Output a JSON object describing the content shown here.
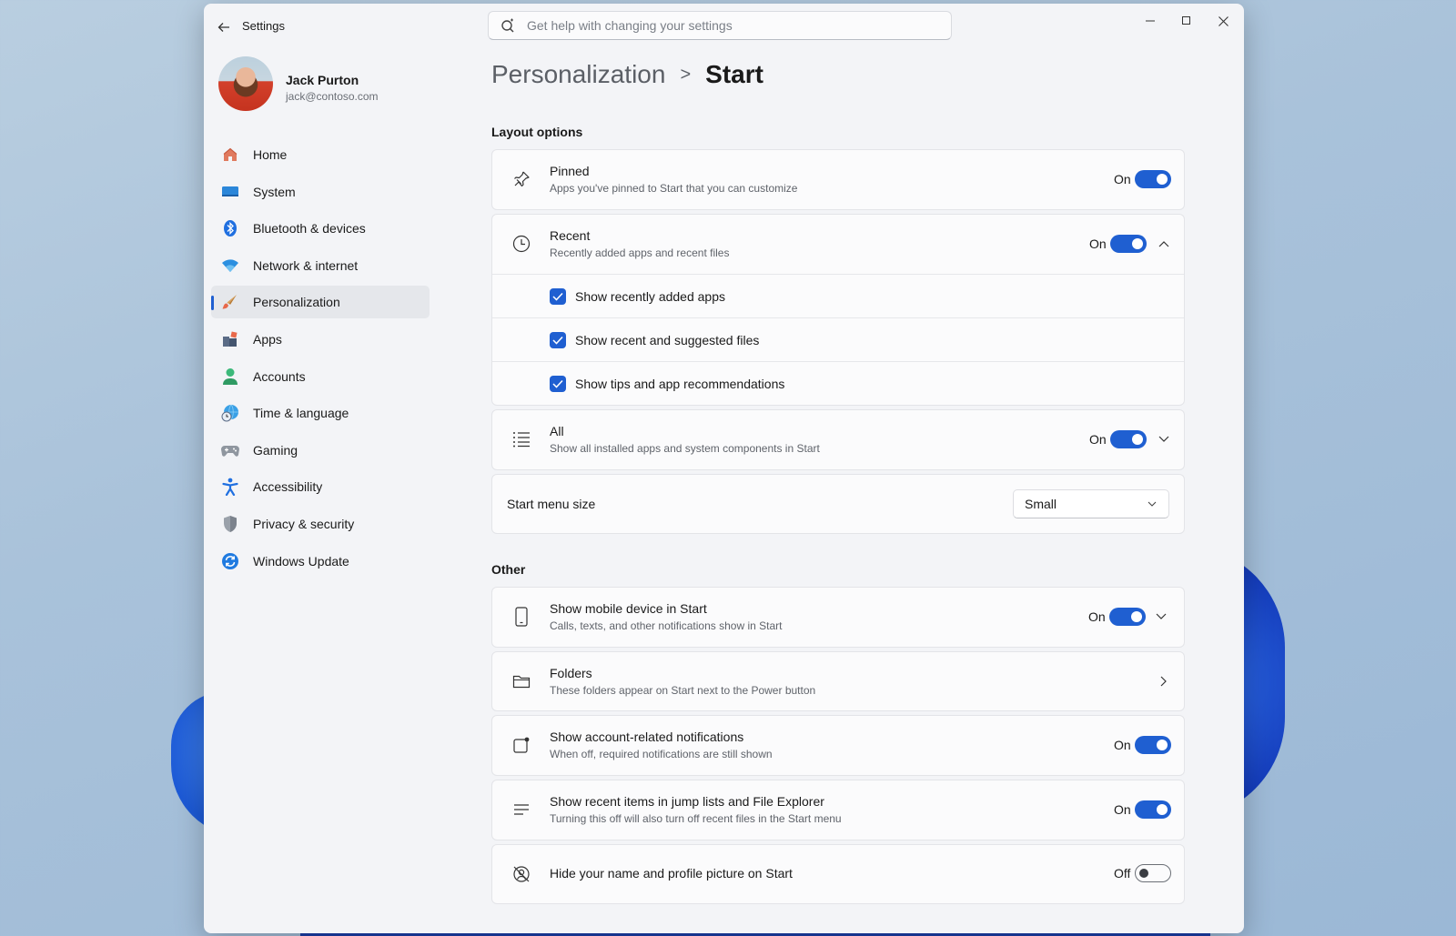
{
  "window": {
    "title": "Settings",
    "search_placeholder": "Get help with changing your settings"
  },
  "profile": {
    "name": "Jack Purton",
    "email": "jack@contoso.com"
  },
  "nav": {
    "items": [
      {
        "label": "Home",
        "icon": "home-icon"
      },
      {
        "label": "System",
        "icon": "system-icon"
      },
      {
        "label": "Bluetooth & devices",
        "icon": "bluetooth-icon"
      },
      {
        "label": "Network & internet",
        "icon": "wifi-icon"
      },
      {
        "label": "Personalization",
        "icon": "brush-icon",
        "active": true
      },
      {
        "label": "Apps",
        "icon": "apps-icon"
      },
      {
        "label": "Accounts",
        "icon": "account-icon"
      },
      {
        "label": "Time & language",
        "icon": "globe-clock-icon"
      },
      {
        "label": "Gaming",
        "icon": "gamepad-icon"
      },
      {
        "label": "Accessibility",
        "icon": "accessibility-icon"
      },
      {
        "label": "Privacy & security",
        "icon": "shield-icon"
      },
      {
        "label": "Windows Update",
        "icon": "update-icon"
      }
    ]
  },
  "breadcrumb": {
    "parent": "Personalization",
    "separator": ">",
    "current": "Start"
  },
  "layout_section": {
    "title": "Layout options",
    "pinned": {
      "title": "Pinned",
      "desc": "Apps you've pinned to Start that you can customize",
      "state": "On",
      "on": true
    },
    "recent": {
      "title": "Recent",
      "desc": "Recently added apps and recent files",
      "state": "On",
      "on": true,
      "expanded": true,
      "options": [
        {
          "label": "Show recently added apps",
          "checked": true
        },
        {
          "label": "Show recent and suggested files",
          "checked": true
        },
        {
          "label": "Show tips and app recommendations",
          "checked": true
        }
      ]
    },
    "all": {
      "title": "All",
      "desc": "Show all installed apps and system components in Start",
      "state": "On",
      "on": true
    },
    "menu_size": {
      "title": "Start menu size",
      "value": "Small"
    }
  },
  "other_section": {
    "title": "Other",
    "mobile": {
      "title": "Show mobile device in Start",
      "desc": "Calls, texts, and other notifications show in Start",
      "state": "On",
      "on": true
    },
    "folders": {
      "title": "Folders",
      "desc": "These folders appear on Start next to the Power button"
    },
    "account_notifications": {
      "title": "Show account-related notifications",
      "desc": "When off, required notifications are still shown",
      "state": "On",
      "on": true
    },
    "recent_items": {
      "title": "Show recent items in jump lists and File Explorer",
      "desc": "Turning this off will also turn off recent files in the Start menu",
      "state": "On",
      "on": true
    },
    "hide_name": {
      "title": "Hide your name and profile picture on Start",
      "state": "Off",
      "on": false
    }
  },
  "colors": {
    "accent": "#1f5fd1",
    "window_bg": "#f3f4f7",
    "card_bg": "#fbfbfc"
  }
}
